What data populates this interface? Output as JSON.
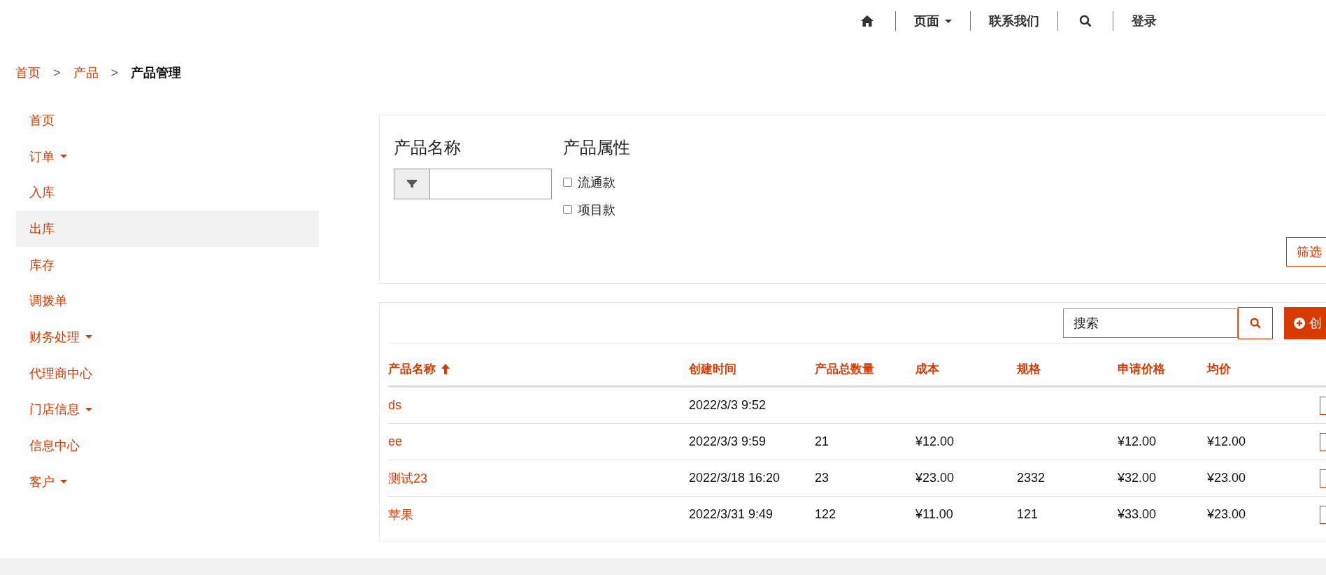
{
  "top_nav": {
    "pages": {
      "label": "页面",
      "dropdown": true
    },
    "contact": "联系我们",
    "login": "登录"
  },
  "breadcrumb": {
    "links": [
      "首页",
      "产品"
    ],
    "separators": [
      ">",
      ">"
    ],
    "current": "产品管理"
  },
  "sidebar": {
    "items": [
      {
        "label": "首页",
        "dropdown": false,
        "selected": false
      },
      {
        "label": "订单",
        "dropdown": true,
        "selected": false
      },
      {
        "label": "入库",
        "dropdown": false,
        "selected": false
      },
      {
        "label": "出库",
        "dropdown": false,
        "selected": true
      },
      {
        "label": "库存",
        "dropdown": false,
        "selected": false
      },
      {
        "label": "调拨单",
        "dropdown": false,
        "selected": false
      },
      {
        "label": "财务处理",
        "dropdown": true,
        "selected": false
      },
      {
        "label": "代理商中心",
        "dropdown": false,
        "selected": false
      },
      {
        "label": "门店信息",
        "dropdown": true,
        "selected": false
      },
      {
        "label": "信息中心",
        "dropdown": false,
        "selected": false
      },
      {
        "label": "客户",
        "dropdown": true,
        "selected": false
      }
    ]
  },
  "filter": {
    "name_label": "产品名称",
    "attr_label": "产品属性",
    "options": [
      {
        "label": "流通款",
        "checked": false
      },
      {
        "label": "项目款",
        "checked": false
      }
    ],
    "button": "筛选"
  },
  "toolbar": {
    "search_value": "搜索",
    "create_button": "创"
  },
  "table": {
    "columns": [
      {
        "label": "产品名称",
        "sorted": true
      },
      {
        "label": "创建时间",
        "sorted": false
      },
      {
        "label": "产品总数量",
        "sorted": false
      },
      {
        "label": "成本",
        "sorted": false
      },
      {
        "label": "规格",
        "sorted": false
      },
      {
        "label": "申请价格",
        "sorted": false
      },
      {
        "label": "均价",
        "sorted": false
      }
    ],
    "rows": [
      {
        "name": "ds",
        "created": "2022/3/3 9:52"
      },
      {
        "name": "ee",
        "created": "2022/3/3 9:59",
        "quantity": "21",
        "cost": "¥12.00",
        "request_price": "¥12.00",
        "avg_price": "¥12.00"
      },
      {
        "name": "测试23",
        "created": "2022/3/18 16:20",
        "quantity": "23",
        "cost": "¥23.00",
        "spec": "2332",
        "request_price": "¥32.00",
        "avg_price": "¥23.00"
      },
      {
        "name": "苹果",
        "created": "2022/3/31 9:49",
        "quantity": "122",
        "cost": "¥11.00",
        "spec": "121",
        "request_price": "¥33.00",
        "avg_price": "¥23.00"
      }
    ]
  }
}
